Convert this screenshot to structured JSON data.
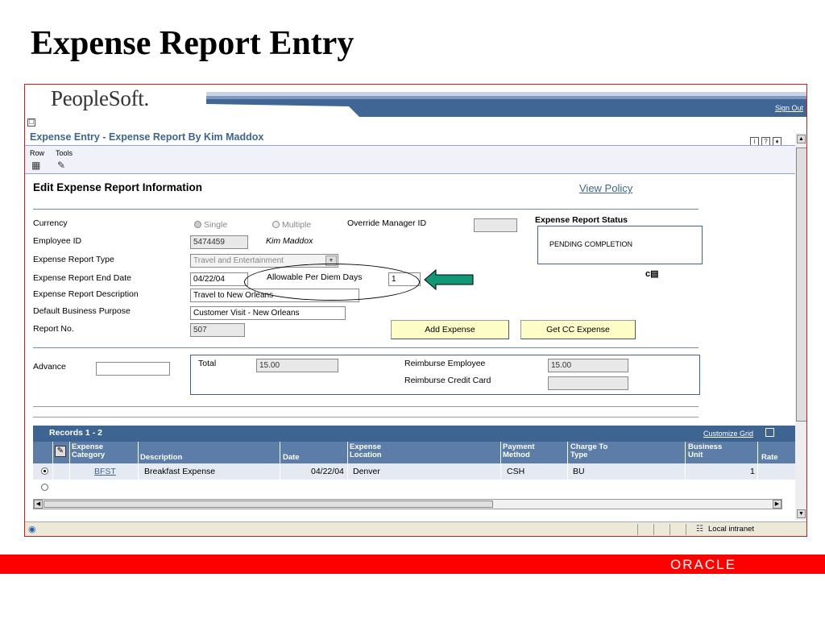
{
  "slide_title": "Expense Report Entry",
  "brand": {
    "logo": "PeopleSoft.",
    "sign_out": "Sign Out"
  },
  "page": {
    "heading": "Expense Entry - Expense Report By Kim Maddox",
    "toolbar": {
      "row_label": "Row",
      "tools_label": "Tools"
    }
  },
  "form": {
    "section_title": "Edit Expense Report Information",
    "view_policy": "View Policy",
    "labels": {
      "currency": "Currency",
      "employee_id": "Employee ID",
      "report_type": "Expense Report Type",
      "end_date": "Expense Report End Date",
      "description": "Expense Report Description",
      "purpose": "Default Business Purpose",
      "report_no": "Report No.",
      "override_manager": "Override Manager ID",
      "per_diem": "Allowable Per Diem Days",
      "status_title": "Expense Report Status",
      "advance": "Advance",
      "total": "Total",
      "reimburse_employee": "Reimburse Employee",
      "reimburse_cc": "Reimburse Credit Card"
    },
    "currency_single": "Single",
    "currency_multiple": "Multiple",
    "employee_id": "5474459",
    "employee_name": "Kim Maddox",
    "report_type": "Travel and Entertainment",
    "end_date": "04/22/04",
    "per_diem_days": "1",
    "description": "Travel to New Orleans",
    "purpose": "Customer Visit - New Orleans",
    "report_no": "507",
    "override_manager_id": "",
    "status": "PENDING COMPLETION",
    "advance": "",
    "total": "15.00",
    "reimburse_employee": "15.00",
    "reimburse_cc": "",
    "add_expense": "Add Expense",
    "get_cc_expense": "Get CC Expense"
  },
  "grid": {
    "records": "Records 1 - 2",
    "customize": "Customize Grid",
    "columns": {
      "category_1": "Expense",
      "category_2": "Category",
      "description": "Description",
      "date": "Date",
      "location_1": "Expense",
      "location_2": "Location",
      "payment_1": "Payment",
      "payment_2": "Method",
      "charge_1": "Charge To",
      "charge_2": "Type",
      "bu_1": "Business",
      "bu_2": "Unit",
      "rate": "Rate"
    },
    "rows": [
      {
        "category": "BFST",
        "description": "Breakfast Expense",
        "date": "04/22/04",
        "location": "Denver",
        "payment": "CSH",
        "charge": "BU",
        "bu": "1"
      }
    ]
  },
  "statusbar": {
    "zone": "Local intranet"
  },
  "footer": {
    "logo": "ORACLE"
  },
  "colors": {
    "accent": "#3e6591",
    "button": "#fdfdc8",
    "band": "#ff0000"
  }
}
